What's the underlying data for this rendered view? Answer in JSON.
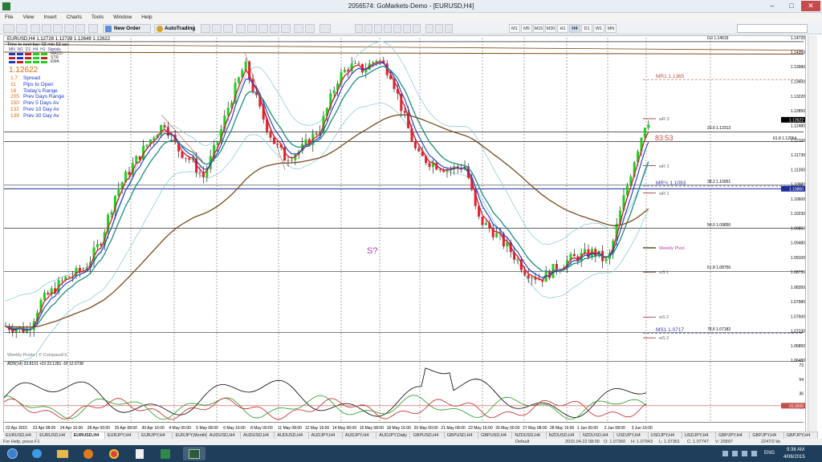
{
  "window": {
    "title": "2056574: GoMarkets-Demo - [EURUSD,H4]",
    "min": "–",
    "max": "□",
    "close": "✕"
  },
  "menu": [
    "File",
    "View",
    "Insert",
    "Charts",
    "Tools",
    "Window",
    "Help"
  ],
  "toolbar": {
    "new_order": "New Order",
    "autotrading": "AutoTrading",
    "timeframes": [
      "M1",
      "M5",
      "M15",
      "M30",
      "H1",
      "H4",
      "D1",
      "W1",
      "MN"
    ],
    "active_timeframe": "H4"
  },
  "chart": {
    "symbol_line": "EURUSD,H4  1.12728 1.12728 1.12649 1.12622",
    "info_line": "Time to next bar: 03 min 53 sec",
    "grid_headers": [
      "MN",
      "W1",
      "D1",
      "H4",
      "H1",
      "Signals"
    ],
    "grid_rows": [
      "MACD",
      "STR",
      "EMA"
    ],
    "price": "1.12622",
    "stats": [
      {
        "value": "1.7",
        "label": "Spread"
      },
      {
        "value": "11",
        "label": "Pips to Open"
      },
      {
        "value": "18",
        "label": "Today's Range"
      },
      {
        "value": "205",
        "label": "Prev Days Range"
      },
      {
        "value": "150",
        "label": "Prev 5 Days Av"
      },
      {
        "value": "132",
        "label": "Prev 10 Day Av"
      },
      {
        "value": "139",
        "label": "Prev 30 Day Av"
      }
    ],
    "watermark": "Weekly Pivots | © CompassFX",
    "countdown": "83:53",
    "annotation": "S?",
    "levels": [
      {
        "label": "MR1  1.1365",
        "price": 1.1365,
        "color": "#c0504d"
      },
      {
        "label": "MR½  1.1093",
        "price": 1.1093,
        "color": "#3a3aaa"
      },
      {
        "label": "MS1  1.0717",
        "price": 1.0717,
        "color": "#3a3aaa"
      }
    ],
    "pivot_labels": [
      {
        "label": "wR 3",
        "price": 1.1265
      },
      {
        "label": "wR 2",
        "price": 1.1145
      },
      {
        "label": "wR 1",
        "price": 1.1075
      },
      {
        "label": "Weekly Pivot",
        "price": 1.0935
      },
      {
        "label": "wS 1",
        "price": 1.0873
      },
      {
        "label": "wS 2",
        "price": 1.0758
      },
      {
        "label": "wS 3",
        "price": 1.0705
      }
    ],
    "fib_labels": [
      {
        "label": "0.0  1.14619",
        "price": 1.14619
      },
      {
        "label": "23.6  1.12313",
        "price": 1.12313
      },
      {
        "label": "61.8  1.12064",
        "price": 1.12064
      },
      {
        "label": "38.2  1.10951",
        "price": 1.10951
      },
      {
        "label": "50.0  1.09850",
        "price": 1.0985
      },
      {
        "label": "61.8  1.08750",
        "price": 1.0875
      },
      {
        "label": "78.6  1.07182",
        "price": 1.07182
      }
    ],
    "price_axis": [
      "1.14720",
      "1.14350",
      "1.13980",
      "1.13600",
      "1.13220",
      "1.12850",
      "1.12480",
      "1.12100",
      "1.11730",
      "1.11350",
      "1.10980",
      "1.10600",
      "1.10230",
      "1.09850",
      "1.09480",
      "1.09100",
      "1.08730",
      "1.08350",
      "1.07980",
      "1.07600",
      "1.07230",
      "1.06850",
      "1.06480"
    ],
    "price_current": "1.12622",
    "price_current_value": 1.12622,
    "price_blue": "1.10860",
    "price_blue_value": 1.1086,
    "price_red": "1.12084",
    "price_red_value": 1.12084,
    "adx_title": "ADX(14) 33.8101 +DI 23.1281 -DI 12.0738",
    "adx_axis": [
      "73",
      "54",
      "36",
      "18"
    ],
    "adx_red_label": "20.0000",
    "adx_red_value": 20,
    "time_axis": [
      "22 Apr 2015",
      "23 Apr 08:00",
      "24 Apr 16:00",
      "28 Apr 00:00",
      "29 Apr 08:00",
      "30 Apr 16:00",
      "4 May 00:00",
      "5 May 08:00",
      "6 May 16:00",
      "8 May 00:00",
      "11 May 08:00",
      "12 May 16:00",
      "14 May 00:00",
      "15 May 08:00",
      "18 May 16:00",
      "20 May 00:00",
      "21 May 08:00",
      "22 May 16:00",
      "26 May 00:00",
      "27 May 08:00",
      "28 May 16:00",
      "1 Jun 00:00",
      "2 Jun 08:00",
      "3 Jun 16:00"
    ]
  },
  "tabs": [
    "EURUSD,H4",
    "EURUSD,H4",
    "EURUSD,H4",
    "EURJPY,H4",
    "EURJPY,H4",
    "EURJPY,Monthly",
    "AUDUSD,H4",
    "AUDUSD,H4",
    "AUDUSD,H4",
    "AUDJPY,H4",
    "AUDJPY,H4",
    "AUDJPY,Daily",
    "GBPUSD,H4",
    "GBPUSD,H4",
    "GBPUSD,H4",
    "NZDUSD,H4",
    "NZDUSD,H4",
    "NZDUSD,H4",
    "USDJPY,H4",
    "USDJPY,H4",
    "USDJPY,H4",
    "GBPJPY,H4",
    "GBPJPY,H4",
    "GBPJPY,H4"
  ],
  "active_tab": 2,
  "status": {
    "help": "For Help, press F1",
    "profile": "Default",
    "datetime": "2015.04.22 08:00",
    "open": "O: 1.07360",
    "high": "H: 1.07943",
    "low": "L: 1.07361",
    "close": "C: 1.07747",
    "volume": "V: 25897",
    "traffic": "2247/2 kb"
  },
  "taskbar": {
    "lang": "ENG",
    "time": "9:36 AM",
    "date": "4/06/2015"
  }
}
